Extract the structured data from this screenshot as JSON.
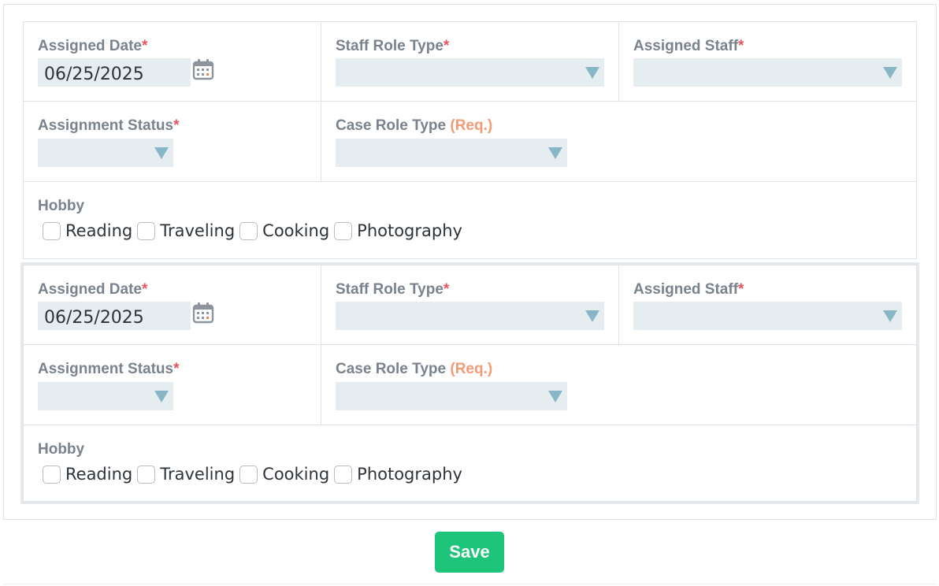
{
  "forms": [
    {
      "assigned_date_label": "Assigned Date",
      "assigned_date_value": "06/25/2025",
      "staff_role_type_label": "Staff Role Type",
      "assigned_staff_label": "Assigned Staff",
      "assignment_status_label": "Assignment Status",
      "case_role_type_label": "Case Role Type",
      "case_role_type_req": "(Req.)",
      "required_marker": "*",
      "hobby_label": "Hobby",
      "hobbies": [
        "Reading",
        "Traveling",
        "Cooking",
        "Photography"
      ]
    },
    {
      "assigned_date_label": "Assigned Date",
      "assigned_date_value": "06/25/2025",
      "staff_role_type_label": "Staff Role Type",
      "assigned_staff_label": "Assigned Staff",
      "assignment_status_label": "Assignment Status",
      "case_role_type_label": "Case Role Type",
      "case_role_type_req": "(Req.)",
      "required_marker": "*",
      "hobby_label": "Hobby",
      "hobbies": [
        "Reading",
        "Traveling",
        "Cooking",
        "Photography"
      ]
    }
  ],
  "footer": {
    "save_label": "Save"
  },
  "colors": {
    "accent": "#1ec479",
    "required": "#e8545f",
    "req_text": "#f29b76",
    "field_bg": "#e6edf1",
    "caret": "#89b6c6"
  },
  "icons": {
    "date_picker": "calendar-icon",
    "select": "caret-down-icon"
  }
}
